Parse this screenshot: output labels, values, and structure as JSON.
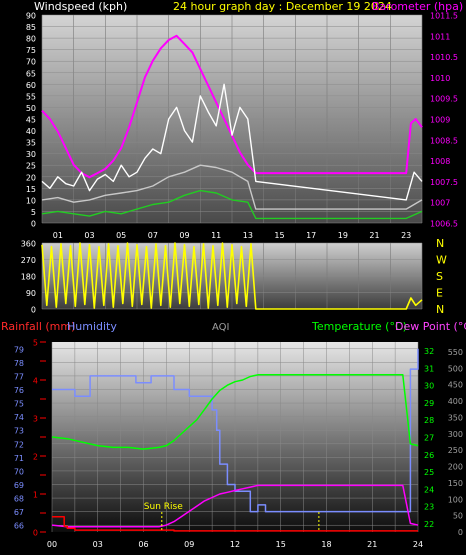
{
  "header": {
    "windspeed_label": "Windspeed (kph)",
    "title": "24 hour graph day : December 19 2024",
    "barometer_label": "Barometer (hpa)"
  },
  "colors": {
    "wind_gust": "#ffffff",
    "wind_avg": "#c8c8c8",
    "wind_green": "#22cc22",
    "barometer": "#ff00ff",
    "direction": "#ffff00",
    "temperature": "#00ff00",
    "dewpoint": "#ff00ff",
    "humidity": "#7b8dff",
    "rainfall": "#ff0000",
    "aqi": "#9f9f9f",
    "sunrise": "#ffff00"
  },
  "bottom_header": {
    "rainfall_label": "Rainfall (mm)",
    "humidity_label": "Humidity",
    "aqi_label": "AQI",
    "temperature_label": "Temperature (°C)",
    "dewpoint_label": "Dew Point (°C)"
  },
  "chart_data": [
    {
      "type": "line",
      "name": "wind-barometer",
      "x_tick_labels": [
        "01",
        "03",
        "05",
        "07",
        "09",
        "11",
        "13",
        "15",
        "17",
        "19",
        "21",
        "23"
      ],
      "y_left_ticks": [
        "90",
        "85",
        "80",
        "75",
        "70",
        "65",
        "60",
        "55",
        "50",
        "45",
        "40",
        "35",
        "30",
        "25",
        "20",
        "15",
        "10",
        "5",
        "0"
      ],
      "y_right_ticks": [
        "1011.5",
        "1011",
        "1010.5",
        "1010",
        "1009.5",
        "1009",
        "1008.5",
        "1008",
        "1007.5",
        "1007",
        "1006.5"
      ],
      "ylim_left": [
        0,
        90
      ],
      "ylim_right": [
        1006.5,
        1011.5
      ],
      "xlim": [
        0,
        24
      ],
      "series": [
        {
          "key": "barometer",
          "axis": "right",
          "x": [
            0,
            0.5,
            1.0,
            1.5,
            2.0,
            2.5,
            3.0,
            3.5,
            4.0,
            4.5,
            5.0,
            5.5,
            6.0,
            6.5,
            7.0,
            7.5,
            8.0,
            8.5,
            9.0,
            9.5,
            10.0,
            10.5,
            11.0,
            11.5,
            12.0,
            12.5,
            13.0,
            13.5,
            14.0,
            23.0,
            23.3,
            23.6,
            24.0
          ],
          "values": [
            1009.2,
            1009.0,
            1008.7,
            1008.3,
            1007.9,
            1007.7,
            1007.6,
            1007.7,
            1007.8,
            1008.0,
            1008.3,
            1008.8,
            1009.4,
            1010.0,
            1010.4,
            1010.7,
            1010.9,
            1011.0,
            1010.8,
            1010.6,
            1010.2,
            1009.8,
            1009.4,
            1009.0,
            1008.6,
            1008.2,
            1007.9,
            1007.7,
            1007.7,
            1007.7,
            1008.9,
            1009.0,
            1008.8
          ]
        },
        {
          "key": "wind_gust",
          "axis": "left",
          "x": [
            0,
            0.5,
            1.0,
            1.5,
            2.0,
            2.5,
            3.0,
            3.5,
            4.0,
            4.5,
            5.0,
            5.5,
            6.0,
            6.5,
            7.0,
            7.5,
            8.0,
            8.5,
            9.0,
            9.5,
            10.0,
            10.5,
            11.0,
            11.5,
            12.0,
            12.5,
            13.0,
            13.5,
            23.0,
            23.5,
            24.0
          ],
          "values": [
            18,
            15,
            20,
            17,
            16,
            22,
            14,
            19,
            21,
            18,
            25,
            20,
            22,
            28,
            32,
            30,
            45,
            50,
            40,
            35,
            55,
            48,
            42,
            60,
            38,
            50,
            45,
            18,
            10,
            22,
            18
          ]
        },
        {
          "key": "wind_avg",
          "axis": "left",
          "x": [
            0,
            1.0,
            2.0,
            3.0,
            4.0,
            5.0,
            6.0,
            7.0,
            8.0,
            9.0,
            10.0,
            11.0,
            12.0,
            13.0,
            13.5,
            23.0,
            24.0
          ],
          "values": [
            10,
            11,
            9,
            10,
            12,
            13,
            14,
            16,
            20,
            22,
            25,
            24,
            22,
            18,
            6,
            6,
            10
          ]
        },
        {
          "key": "wind_green",
          "axis": "left",
          "x": [
            0,
            1.0,
            2.0,
            3.0,
            4.0,
            5.0,
            6.0,
            7.0,
            8.0,
            9.0,
            10.0,
            11.0,
            12.0,
            13.0,
            13.5,
            23.0,
            24.0
          ],
          "values": [
            4,
            5,
            4,
            3,
            5,
            4,
            6,
            8,
            9,
            12,
            14,
            13,
            10,
            9,
            2,
            2,
            5
          ]
        }
      ]
    },
    {
      "type": "line",
      "name": "wind-direction",
      "y_left_ticks": [
        "360",
        "270",
        "180",
        "90",
        "0"
      ],
      "y_right_ticks": [
        "N",
        "W",
        "S",
        "E",
        "N"
      ],
      "ylim": [
        0,
        360
      ],
      "series": [
        {
          "key": "direction",
          "x": [
            0.0,
            0.3,
            0.6,
            0.9,
            1.2,
            1.5,
            1.8,
            2.1,
            2.4,
            2.7,
            3.0,
            3.3,
            3.6,
            3.9,
            4.2,
            4.5,
            4.8,
            5.1,
            5.4,
            5.7,
            6.0,
            6.3,
            6.6,
            6.9,
            7.2,
            7.5,
            7.8,
            8.1,
            8.4,
            8.7,
            9.0,
            9.3,
            9.6,
            9.9,
            10.2,
            10.5,
            10.8,
            11.1,
            11.4,
            11.7,
            12.0,
            12.3,
            12.6,
            12.9,
            13.2,
            13.5,
            23.0,
            23.3,
            23.6,
            24.0
          ],
          "values": [
            350,
            20,
            340,
            10,
            355,
            30,
            345,
            15,
            360,
            25,
            350,
            5,
            340,
            20,
            355,
            10,
            345,
            30,
            360,
            15,
            350,
            25,
            340,
            5,
            355,
            20,
            345,
            10,
            360,
            30,
            350,
            15,
            340,
            25,
            355,
            5,
            345,
            20,
            360,
            10,
            350,
            30,
            340,
            15,
            355,
            0,
            0,
            60,
            20,
            50
          ]
        }
      ]
    },
    {
      "type": "line",
      "name": "temp-humidity-rain",
      "x_tick_labels": [
        "00",
        "03",
        "06",
        "09",
        "12",
        "15",
        "18",
        "21",
        "24"
      ],
      "y_left_rain_ticks": [
        "5",
        "",
        "4",
        "",
        "3",
        "",
        "2",
        "",
        "1",
        "",
        "0"
      ],
      "y_left_humidity_ticks": [
        "79",
        "78",
        "77",
        "76",
        "75",
        "74",
        "73",
        "72",
        "71",
        "70",
        "69",
        "68",
        "67",
        "66"
      ],
      "y_right_temp_ticks": [
        "32",
        "31",
        "30",
        "29",
        "28",
        "27",
        "26",
        "25",
        "24",
        "23",
        "22"
      ],
      "y_right_aqi_ticks": [
        "550",
        "500",
        "450",
        "400",
        "350",
        "300",
        "250",
        "200",
        "150",
        "100",
        "50",
        "0"
      ],
      "ylim_temp": [
        21.5,
        32.5
      ],
      "ylim_humidity": [
        65.5,
        79.5
      ],
      "ylim_rain": [
        0,
        5
      ],
      "sunrise_label": "Sun Rise",
      "sunrise_x": 7.2,
      "markers_x": [
        17.5
      ],
      "series": [
        {
          "key": "humidity",
          "axis": "humidity",
          "x": [
            0,
            1.0,
            1.5,
            2.5,
            3.0,
            5.0,
            5.5,
            6.5,
            7.5,
            8.0,
            9.0,
            10.0,
            10.5,
            10.8,
            11.0,
            11.5,
            12.0,
            12.5,
            13.0,
            13.5,
            14.0,
            23.0,
            23.5,
            24.0
          ],
          "values": [
            76,
            76,
            75.5,
            77,
            77,
            77,
            76.5,
            77,
            77,
            76,
            75.5,
            75.5,
            74.5,
            73,
            70.5,
            69,
            68.5,
            68.5,
            67,
            67.5,
            67,
            67,
            77.5,
            79
          ]
        },
        {
          "key": "temperature",
          "axis": "temp",
          "x": [
            0,
            1.0,
            2.0,
            3.0,
            4.0,
            5.0,
            6.0,
            7.0,
            7.5,
            8.0,
            8.5,
            9.0,
            9.5,
            10.0,
            10.5,
            11.0,
            11.5,
            12.0,
            12.5,
            13.0,
            13.5,
            14.0,
            18.0,
            23.0,
            23.5,
            24.0
          ],
          "values": [
            27,
            26.9,
            26.7,
            26.5,
            26.4,
            26.4,
            26.3,
            26.4,
            26.5,
            26.8,
            27.2,
            27.6,
            28.0,
            28.6,
            29.2,
            29.7,
            30.0,
            30.2,
            30.3,
            30.5,
            30.6,
            30.6,
            30.6,
            30.6,
            26.6,
            26.5
          ]
        },
        {
          "key": "dewpoint",
          "axis": "temp",
          "x": [
            0,
            1.0,
            2.0,
            3.0,
            4.0,
            5.0,
            6.0,
            7.0,
            7.5,
            8.0,
            8.5,
            9.0,
            9.5,
            10.0,
            10.5,
            11.0,
            11.5,
            12.0,
            12.5,
            13.0,
            13.5,
            14.0,
            23.0,
            23.5,
            24.0
          ],
          "values": [
            21.9,
            21.8,
            21.8,
            21.8,
            21.8,
            21.8,
            21.8,
            21.8,
            21.9,
            22.1,
            22.4,
            22.7,
            23.0,
            23.3,
            23.5,
            23.7,
            23.8,
            23.9,
            24.0,
            24.1,
            24.2,
            24.2,
            24.2,
            22.0,
            21.9
          ]
        },
        {
          "key": "rainfall",
          "axis": "rain",
          "x": [
            0,
            0.6,
            0.8,
            1.0,
            1.5,
            4.0,
            8.0,
            12.0,
            16.0,
            20.0,
            23.0,
            24.0
          ],
          "values": [
            0.4,
            0.4,
            0.15,
            0.1,
            0.05,
            0.05,
            0.03,
            0.03,
            0.03,
            0.03,
            0.03,
            0.03
          ]
        }
      ]
    }
  ]
}
